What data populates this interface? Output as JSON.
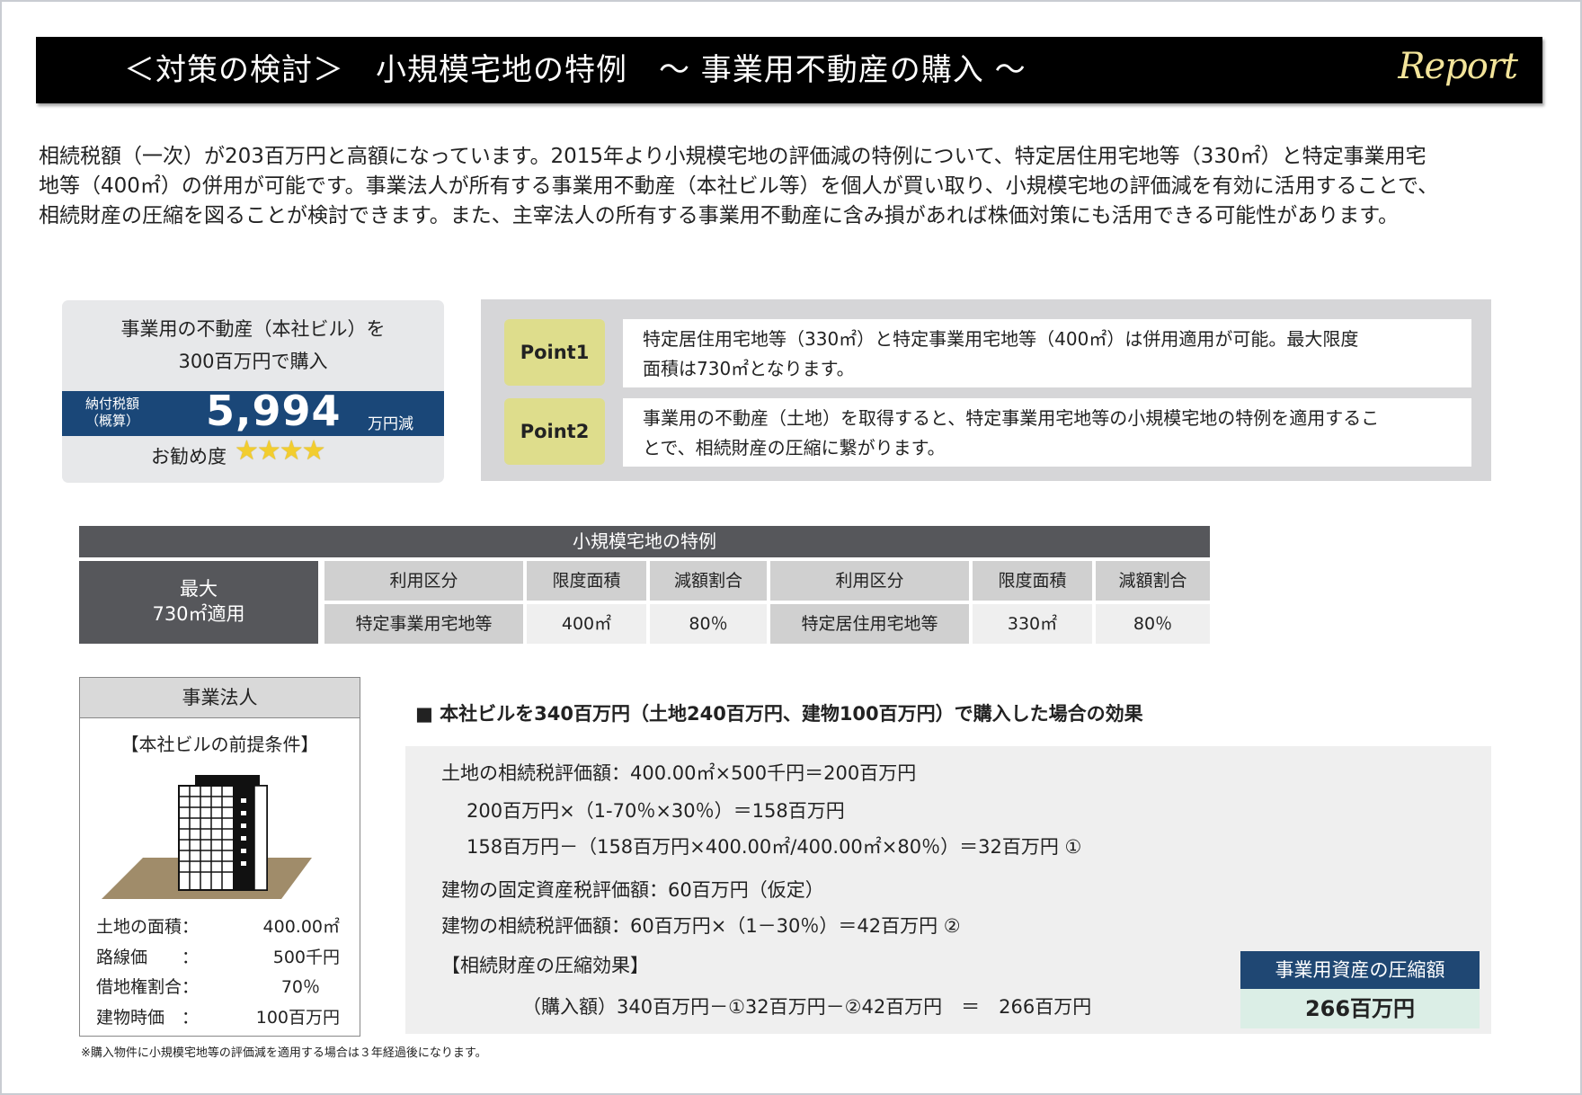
{
  "header": {
    "title": "＜対策の検討＞　小規模宅地の特例　～ 事業用不動産の購入 ～",
    "logo_text": "Report"
  },
  "intro": {
    "lines": [
      "相続税額（一次）が203百万円と高額になっています。2015年より小規模宅地の評価減の特例について、特定居住用宅地等（330㎡）と特定事業用宅",
      "地等（400㎡）の併用が可能です。事業法人が所有する事業用不動産（本社ビル等）を個人が買い取り、小規模宅地の評価減を有効に活用することで、",
      "相続財産の圧縮を図ることが検討できます。また、主宰法人の所有する事業用不動産に含み損があれば株価対策にも活用できる可能性があります。"
    ]
  },
  "summary_card": {
    "line1": "事業用の不動産（本社ビル）を",
    "line2": "300百万円で購入",
    "tax_label_1": "納付税額",
    "tax_label_2": "（概算）",
    "tax_value": "5,994",
    "tax_unit": "万円減",
    "recommend_label": "お勧め度",
    "stars": "★★★★",
    "rating": 4
  },
  "points": [
    {
      "badge": "Point1",
      "line1": "特定居住用宅地等（330㎡）と特定事業用宅地等（400㎡）は併用適用が可能。最大限度",
      "line2": "面積は730㎡となります。"
    },
    {
      "badge": "Point2",
      "line1": "事業用の不動産（土地）を取得すると、特定事業用宅地等の小規模宅地の特例を適用するこ",
      "line2": "とで、相続財産の圧縮に繋がります。"
    }
  ],
  "table": {
    "title": "小規模宅地の特例",
    "side_1": "最大",
    "side_2": "730㎡適用",
    "headers": [
      "利用区分",
      "限度面積",
      "減額割合",
      "利用区分",
      "限度面積",
      "減額割合"
    ],
    "row": [
      "特定事業用宅地等",
      "400㎡",
      "80％",
      "特定居住用宅地等",
      "330㎡",
      "80％"
    ]
  },
  "company": {
    "title": "事業法人",
    "subtitle": "【本社ビルの前提条件】",
    "items": [
      {
        "label": "土地の面積：",
        "value": "400.00㎡"
      },
      {
        "label": "路線価　　：",
        "value": "500千円"
      },
      {
        "label": "借地権割合：",
        "value": "70％"
      },
      {
        "label": "建物時価　：",
        "value": "100百万円"
      }
    ]
  },
  "effect": {
    "title": "■ 本社ビルを340百万円（土地240百万円、建物100百万円）で購入した場合の効果",
    "lines": [
      "土地の相続税評価額：400.00㎡×500千円＝200百万円",
      "200百万円×（1-70％×30％）＝158百万円",
      "158百万円－（158百万円×400.00㎡/400.00㎡×80％）＝32百万円 ①",
      "建物の固定資産税評価額：60百万円（仮定）",
      "建物の相続税評価額：60百万円×（1－30％）＝42百万円 ②",
      "【相続財産の圧縮効果】",
      "（購入額）340百万円－①32百万円－②42百万円　＝　266百万円"
    ],
    "result_label": "事業用資産の圧縮額",
    "result_value": "266百万円"
  },
  "footnote": "※購入物件に小規模宅地等の評価減を適用する場合は３年経過後になります。"
}
